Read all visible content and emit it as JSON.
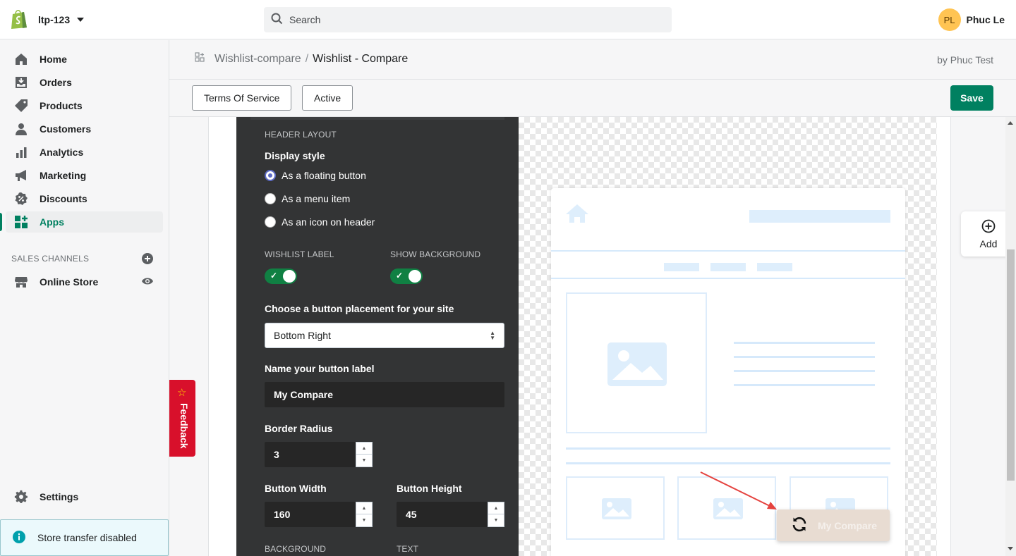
{
  "topbar": {
    "store_name": "ltp-123",
    "logo_icon": "shopify-bag-icon",
    "search_placeholder": "Search",
    "user_initials": "PL",
    "user_name": "Phuc Le"
  },
  "sidebar": {
    "items": [
      {
        "label": "Home",
        "icon": "home-icon"
      },
      {
        "label": "Orders",
        "icon": "orders-icon"
      },
      {
        "label": "Products",
        "icon": "tag-icon"
      },
      {
        "label": "Customers",
        "icon": "person-icon"
      },
      {
        "label": "Analytics",
        "icon": "bar-chart-icon"
      },
      {
        "label": "Marketing",
        "icon": "megaphone-icon"
      },
      {
        "label": "Discounts",
        "icon": "discount-icon"
      },
      {
        "label": "Apps",
        "icon": "apps-icon"
      }
    ],
    "active_item": "Apps",
    "sales_channels_title": "SALES CHANNELS",
    "online_store_label": "Online Store",
    "settings_label": "Settings",
    "store_transfer_label": "Store transfer disabled"
  },
  "feedback": {
    "label": "Feedback"
  },
  "header": {
    "breadcrumb_parent": "Wishlist-compare",
    "breadcrumb_separator": "/",
    "breadcrumb_current": "Wishlist - Compare",
    "by_line": "by Phuc Test"
  },
  "actions": {
    "terms_label": "Terms Of Service",
    "active_label": "Active",
    "save_label": "Save"
  },
  "settings": {
    "header_layout_label": "HEADER LAYOUT",
    "display_style_title": "Display style",
    "display_options": [
      "As a floating button",
      "As a menu item",
      "As an icon on header"
    ],
    "display_selected": "As a floating button",
    "wishlist_label_title": "WISHLIST LABEL",
    "wishlist_label_on": true,
    "show_background_title": "SHOW BACKGROUND",
    "show_background_on": true,
    "placement_title": "Choose a button placement for your site",
    "placement_value": "Bottom Right",
    "button_label_title": "Name your button label",
    "button_label_value": "My Compare",
    "border_radius_title": "Border Radius",
    "border_radius_value": "3",
    "button_width_title": "Button Width",
    "button_width_value": "160",
    "button_height_title": "Button Height",
    "button_height_value": "45",
    "background_title": "BACKGROUND",
    "text_title": "TEXT"
  },
  "preview": {
    "floating_button_label": "My Compare",
    "floating_button_icon": "sync-icon",
    "floating_button_bg": "#e8dcd2",
    "annotation_arrow_color": "#e5433f"
  },
  "add_widget": {
    "label": "Add"
  },
  "colors": {
    "primary_green": "#008060",
    "panel_dark": "#333435",
    "feedback_red": "#d8102b",
    "toggle_green": "#108043"
  }
}
